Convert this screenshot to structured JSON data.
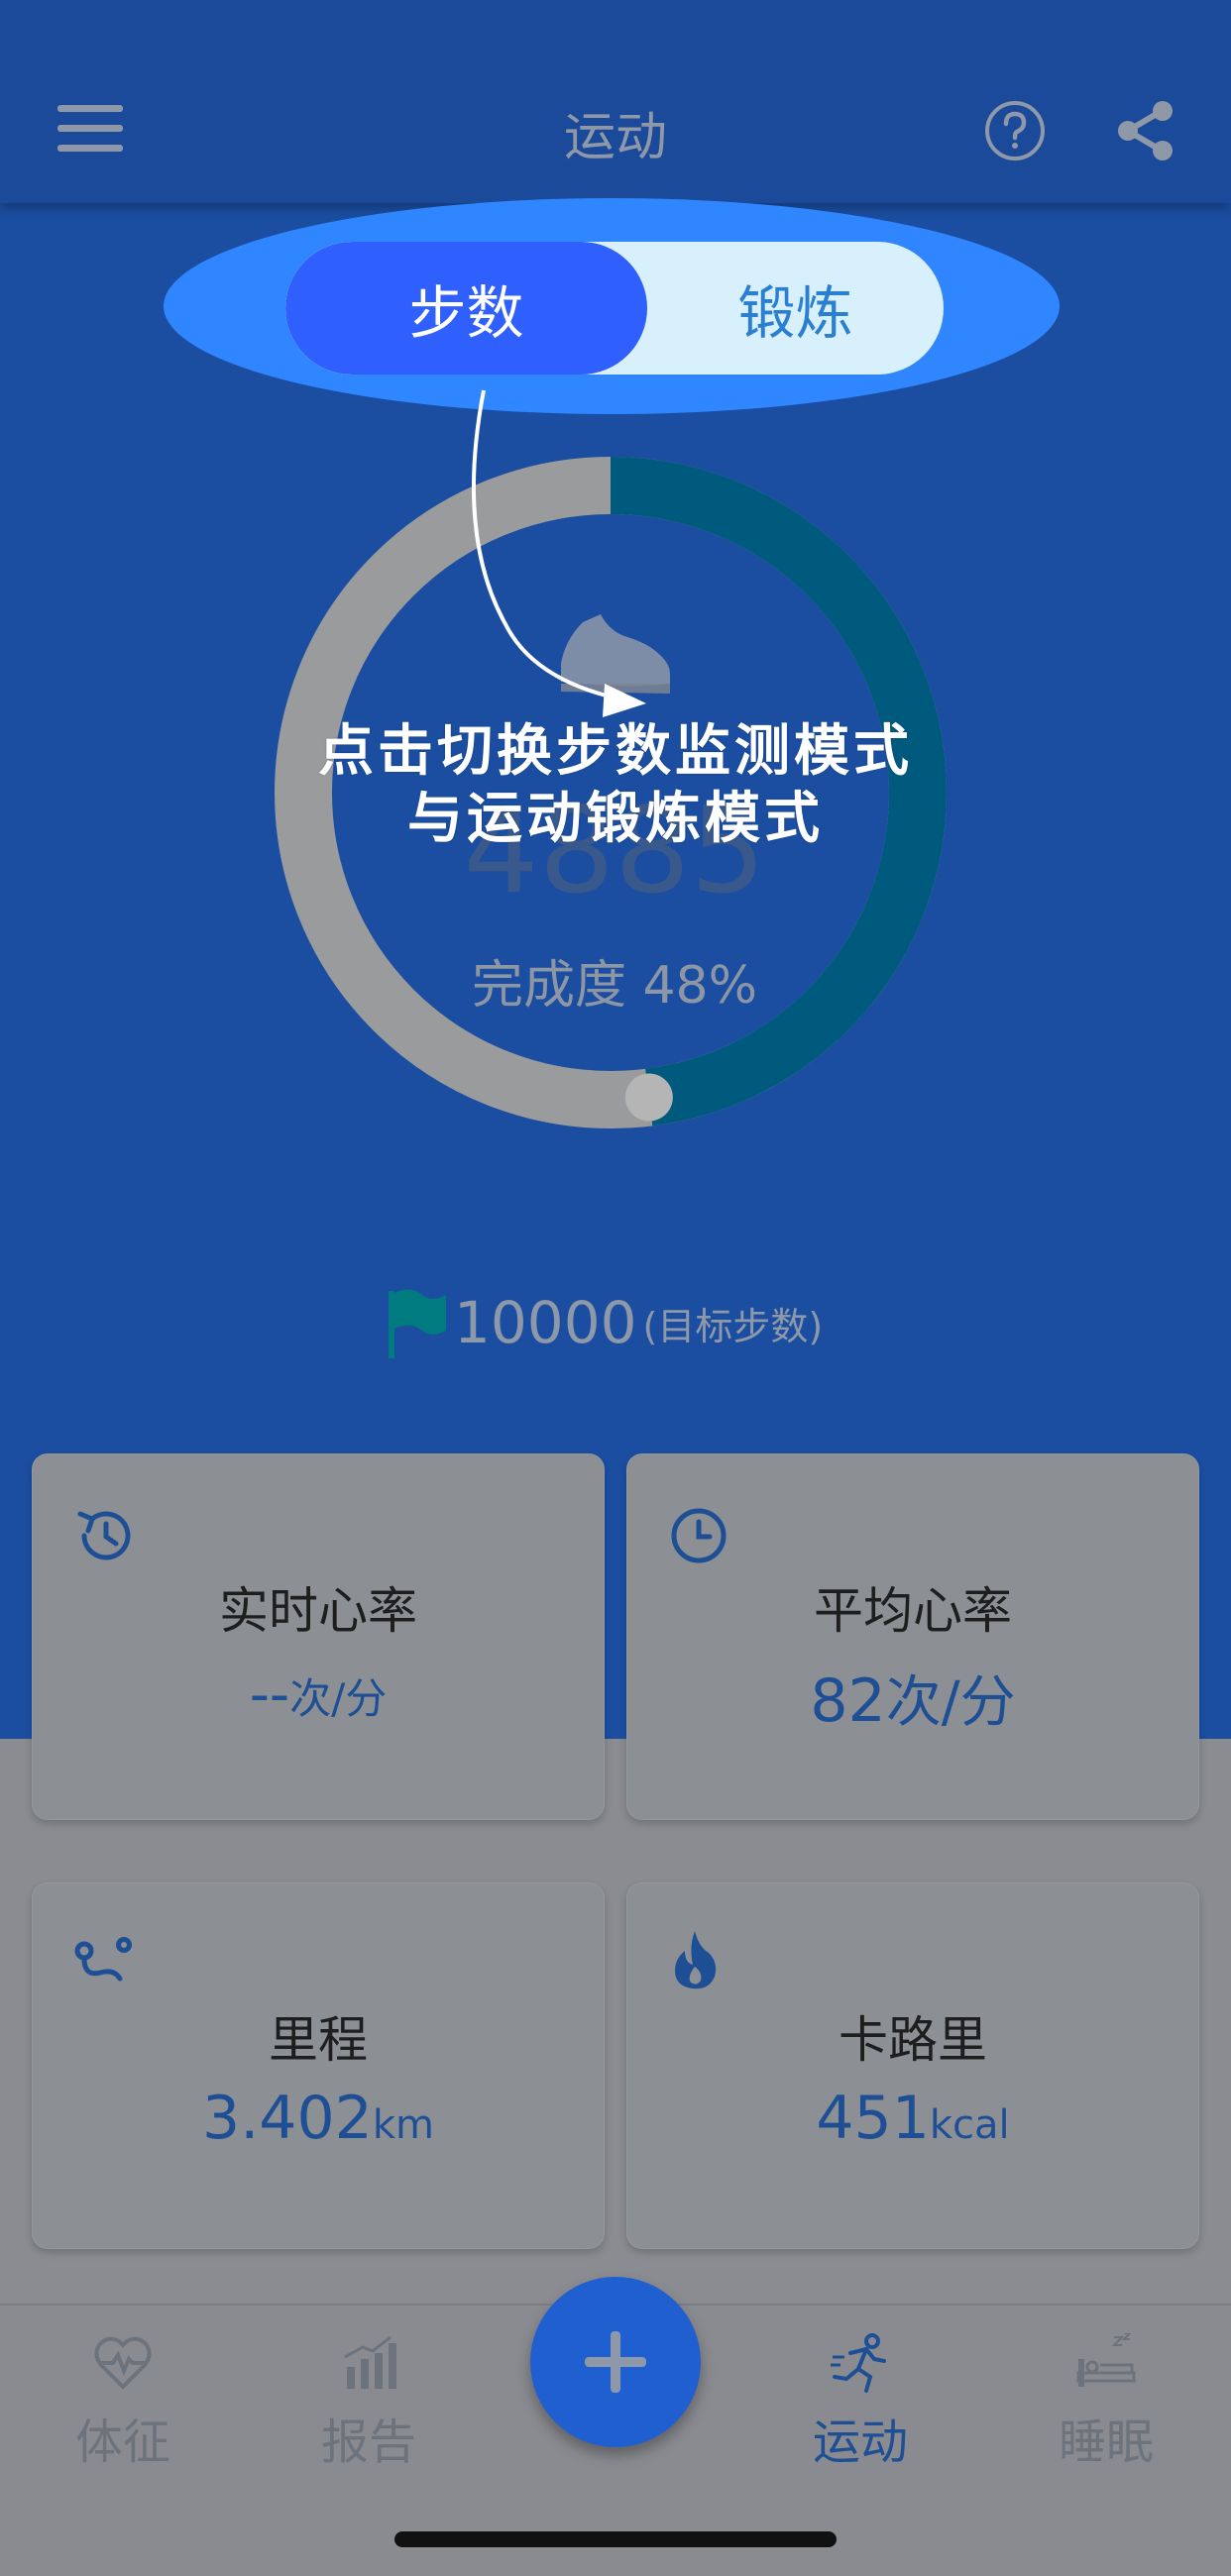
{
  "header": {
    "title": "运动"
  },
  "segmented": {
    "active_label": "步数",
    "other_label": "锻炼"
  },
  "hint": {
    "line1": "点击切换步数监测模式",
    "line2": "与运动锻炼模式"
  },
  "progress": {
    "steps": "4885",
    "completion_label": "完成度 48%",
    "fraction": 0.48
  },
  "goal": {
    "value": "10000",
    "label": "(目标步数)"
  },
  "cards": {
    "realtime_hr": {
      "title": "实时心率",
      "value": "--",
      "unit": "次/分"
    },
    "avg_hr": {
      "title": "平均心率",
      "value": "82",
      "unit": "次/分"
    },
    "distance": {
      "title": "里程",
      "value": "3.402",
      "unit": "km"
    },
    "calories": {
      "title": "卡路里",
      "value": "451",
      "unit": "kcal"
    }
  },
  "tabs": [
    {
      "label": "体征",
      "icon": "heart-pulse-icon"
    },
    {
      "label": "报告",
      "icon": "bar-chart-icon"
    },
    {
      "label": "运动",
      "icon": "running-icon"
    },
    {
      "label": "睡眠",
      "icon": "bed-icon"
    }
  ],
  "colors": {
    "primary": "#1b4ea1",
    "accent": "#2f5ffc",
    "highlight": "#2f86ff",
    "ring": "#005a7e"
  }
}
